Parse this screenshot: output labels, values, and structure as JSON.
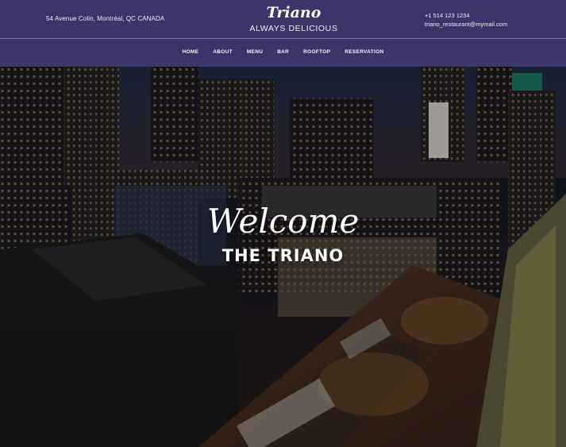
{
  "header": {
    "address": "54 Avenue Colin, Montréal, QC CANADA",
    "brand_name": "Triano",
    "brand_tagline": "ALWAYS DELICIOUS",
    "phone": "+1 514 123 1234",
    "email": "triano_restaurant@mymail.com"
  },
  "nav": {
    "items": [
      "HOME",
      "ABOUT",
      "MENU",
      "BAR",
      "ROOFTOP",
      "RESERVATION"
    ]
  },
  "hero": {
    "welcome": "Welcome",
    "subtitle": "THE TRIANO"
  },
  "colors": {
    "header_bg": "#3b3569",
    "text": "#ffffff"
  }
}
